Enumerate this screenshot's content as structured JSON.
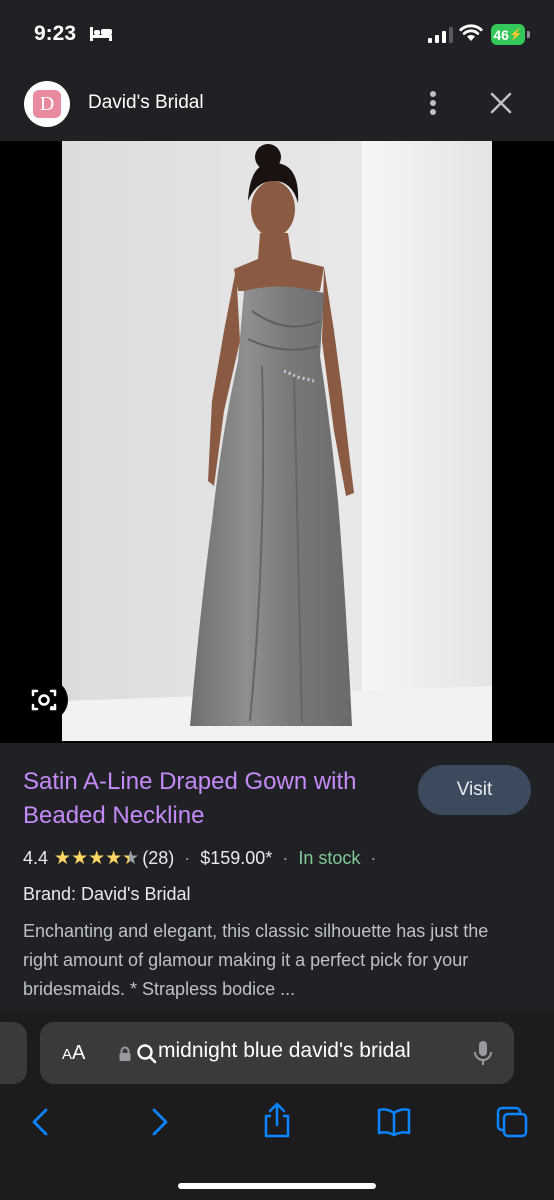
{
  "status_bar": {
    "time": "9:23",
    "battery": "46"
  },
  "header": {
    "logo_letter": "D",
    "site_name": "David's Bridal"
  },
  "product": {
    "title": "Satin A-Line Draped Gown with Beaded Neckline",
    "visit_label": "Visit",
    "rating": "4.4",
    "stars": "★★★★",
    "review_count": "(28)",
    "price": "$159.00*",
    "availability": "In stock",
    "brand": "Brand: David's Bridal",
    "description": "Enchanting and elegant, this classic silhouette has just the right amount of glamour making it a perfect pick for your bridesmaids. * Strapless bodice ..."
  },
  "browser": {
    "aa_label": "AA",
    "url_text": "midnight blue david's bridal"
  },
  "colors": {
    "title": "#c58af9",
    "stars": "#fdd663",
    "in_stock": "#81c995",
    "visit_bg": "#3c4a5e",
    "accent_blue": "#0a84ff"
  }
}
